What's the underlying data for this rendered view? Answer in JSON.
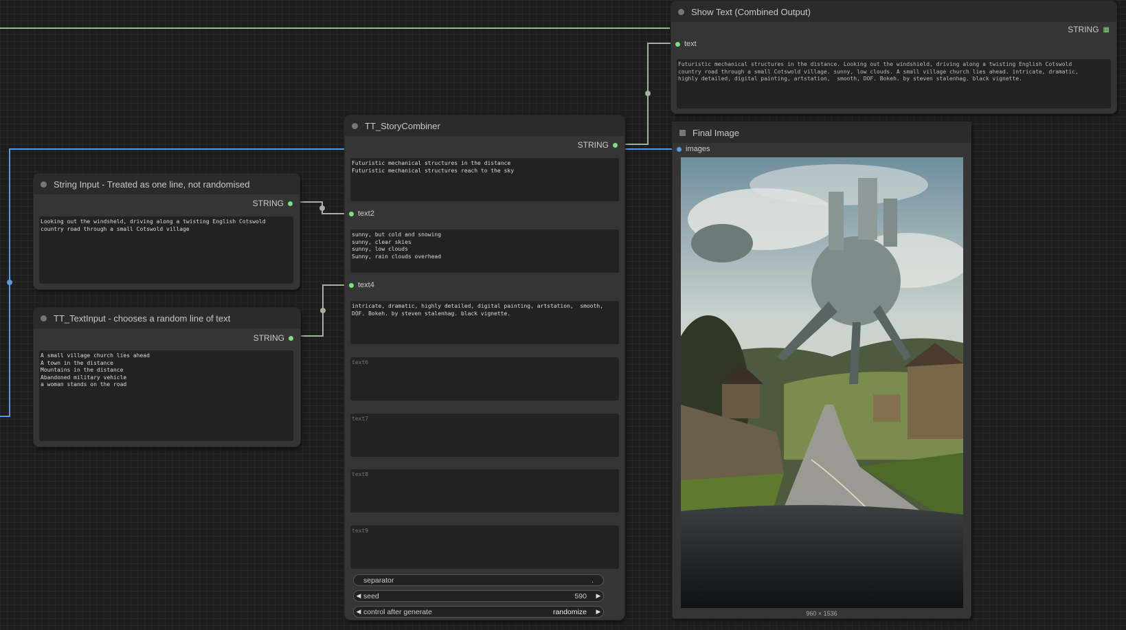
{
  "nodes": {
    "string_input": {
      "title": "String Input - Treated as one line, not randomised",
      "output": "STRING",
      "text": "Looking out the windsheld, driving along a twisting English Cotswold\ncountry road through a small Cotswold village"
    },
    "text_input": {
      "title": "TT_TextInput - chooses a random line of text",
      "output": "STRING",
      "text": "A small village church lies ahead\nA town in the distance\nMountains in the distance\nAbandoned military vehicle\na woman stands on the road"
    },
    "combiner": {
      "title": "TT_StoryCombiner",
      "output": "STRING",
      "text1": "Futuristic mechanical structures in the distance\nFuturistic mechanical structures reach to the sky",
      "input_text2": "text2",
      "text3": "sunny, but cold and snowing\nsunny, clear skies\nsunny, low clouds\nSunny, rain clouds overhead",
      "input_text4": "text4",
      "text5": "intricate, dramatic, highly detailed, digital painting, artstation,  smooth,\nDOF. Bokeh. by steven stalenhag. black vignette.",
      "text6": "text6",
      "text7": "text7",
      "text8": "text8",
      "text9": "text9",
      "separator_label": "separator",
      "separator_value": ".",
      "seed_label": "seed",
      "seed_value": "590",
      "control_label": "control after generate",
      "control_value": "randomize"
    },
    "show_text": {
      "title": "Show Text (Combined Output)",
      "output": "STRING",
      "input": "text",
      "text": "Futuristic mechanical structures in the distance. Looking out the windshield, driving along a twisting English Cotswold\ncountry road through a small Cotswold village. sunny, low clouds. A small village church lies ahead. intricate, dramatic,\nhighly detailed, digital painting, artstation,  smooth, DOF. Bokeh. by steven stalenhag. black vignette."
    },
    "final_image": {
      "title": "Final Image",
      "input": "images",
      "dimensions": "960 × 1536"
    }
  },
  "colors": {
    "string_link": "#9fb59b",
    "image_link": "#5b9be0",
    "slot_green": "#7ce07c"
  }
}
